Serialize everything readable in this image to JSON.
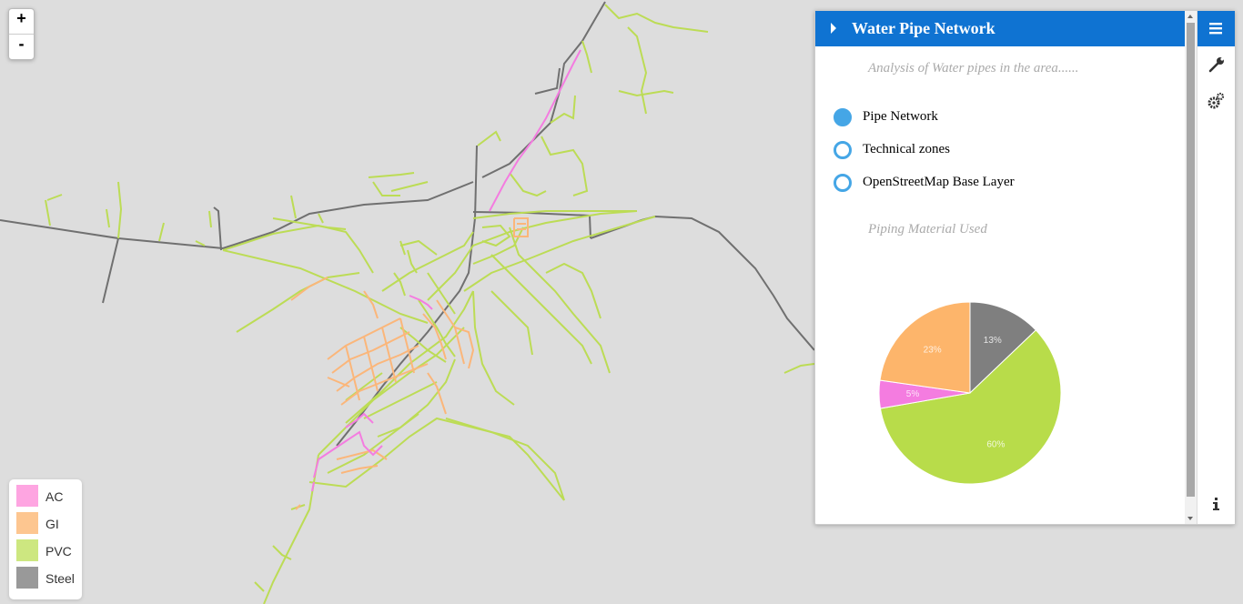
{
  "map": {
    "zoom_in_label": "+",
    "zoom_out_label": "-",
    "legend": [
      {
        "label": "AC",
        "color": "#fea5e1"
      },
      {
        "label": "GI",
        "color": "#fdc690"
      },
      {
        "label": "PVC",
        "color": "#cde780"
      },
      {
        "label": "Steel",
        "color": "#999999"
      }
    ]
  },
  "panel": {
    "title": "Water Pipe Network",
    "subtitle": "Analysis of Water pipes in the area......",
    "layers": [
      {
        "label": "Pipe Network",
        "selected": true
      },
      {
        "label": "Technical zones",
        "selected": false
      },
      {
        "label": "OpenStreetMap Base Layer",
        "selected": false
      }
    ],
    "chart_section_title": "Piping Material Used",
    "tabs": [
      {
        "icon": "layers-menu-icon",
        "active": true
      },
      {
        "icon": "wrench-icon",
        "active": false
      },
      {
        "icon": "gears-icon",
        "active": false
      },
      {
        "icon": "info-icon",
        "active": false
      }
    ]
  },
  "colors": {
    "accent": "#0f73d2",
    "radio": "#45a6e6"
  },
  "chart_data": {
    "type": "pie",
    "title": "Piping Material Used",
    "slices": [
      {
        "label": "Steel",
        "value": 13,
        "text": "13%",
        "color": "#7f7f7f"
      },
      {
        "label": "PVC",
        "value": 60,
        "text": "60%",
        "color": "#b8dc4a"
      },
      {
        "label": "AC",
        "value": 5,
        "text": "5%",
        "color": "#f47ce0"
      },
      {
        "label": "GI",
        "value": 23,
        "text": "23%",
        "color": "#fdb56b"
      }
    ]
  }
}
